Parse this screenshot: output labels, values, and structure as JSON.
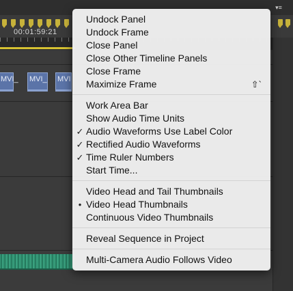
{
  "timeline": {
    "timecode": "00:01:59:21",
    "clips": [
      {
        "label": "MVI_"
      },
      {
        "label": "MVI_"
      },
      {
        "label": "MVI"
      }
    ]
  },
  "colors": {
    "clip": "#5b74a8",
    "audio": "#2f8c6d",
    "marker": "#c7b23a"
  },
  "menu": {
    "groups": [
      [
        {
          "label": "Undock Panel",
          "check": ""
        },
        {
          "label": "Undock Frame",
          "check": ""
        },
        {
          "label": "Close Panel",
          "check": ""
        },
        {
          "label": "Close Other Timeline Panels",
          "check": ""
        },
        {
          "label": "Close Frame",
          "check": ""
        },
        {
          "label": "Maximize Frame",
          "check": "",
          "shortcut": "⇧`"
        }
      ],
      [
        {
          "label": "Work Area Bar",
          "check": ""
        },
        {
          "label": "Show Audio Time Units",
          "check": ""
        },
        {
          "label": "Audio Waveforms Use Label Color",
          "check": "✓"
        },
        {
          "label": "Rectified Audio Waveforms",
          "check": "✓"
        },
        {
          "label": "Time Ruler Numbers",
          "check": "✓"
        },
        {
          "label": "Start Time...",
          "check": ""
        }
      ],
      [
        {
          "label": "Video Head and Tail Thumbnails",
          "check": ""
        },
        {
          "label": "Video Head Thumbnails",
          "check": "•"
        },
        {
          "label": "Continuous Video Thumbnails",
          "check": ""
        }
      ],
      [
        {
          "label": "Reveal Sequence in Project",
          "check": ""
        }
      ],
      [
        {
          "label": "Multi-Camera Audio Follows Video",
          "check": ""
        }
      ]
    ]
  }
}
